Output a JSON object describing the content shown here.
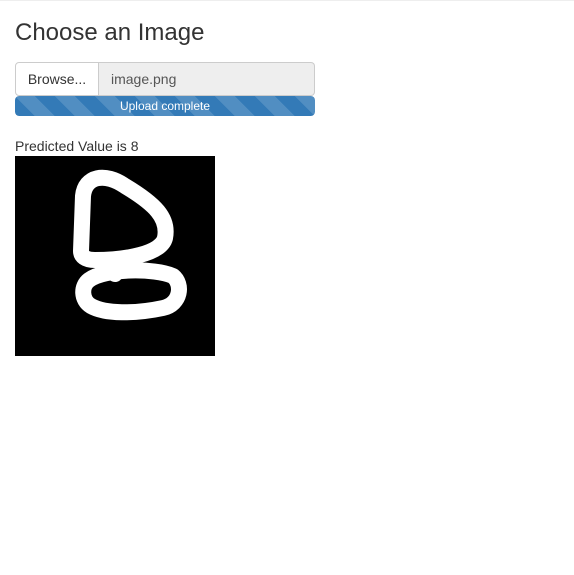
{
  "page": {
    "heading": "Choose an Image"
  },
  "file_input": {
    "browse_label": "Browse...",
    "file_name": "image.png"
  },
  "upload": {
    "status_text": "Upload complete",
    "progress_fraction": 1.0,
    "bar_color": "#337ab7"
  },
  "result": {
    "prediction_text": "Predicted Value is 8",
    "image_alt": "uploaded-digit-image"
  }
}
